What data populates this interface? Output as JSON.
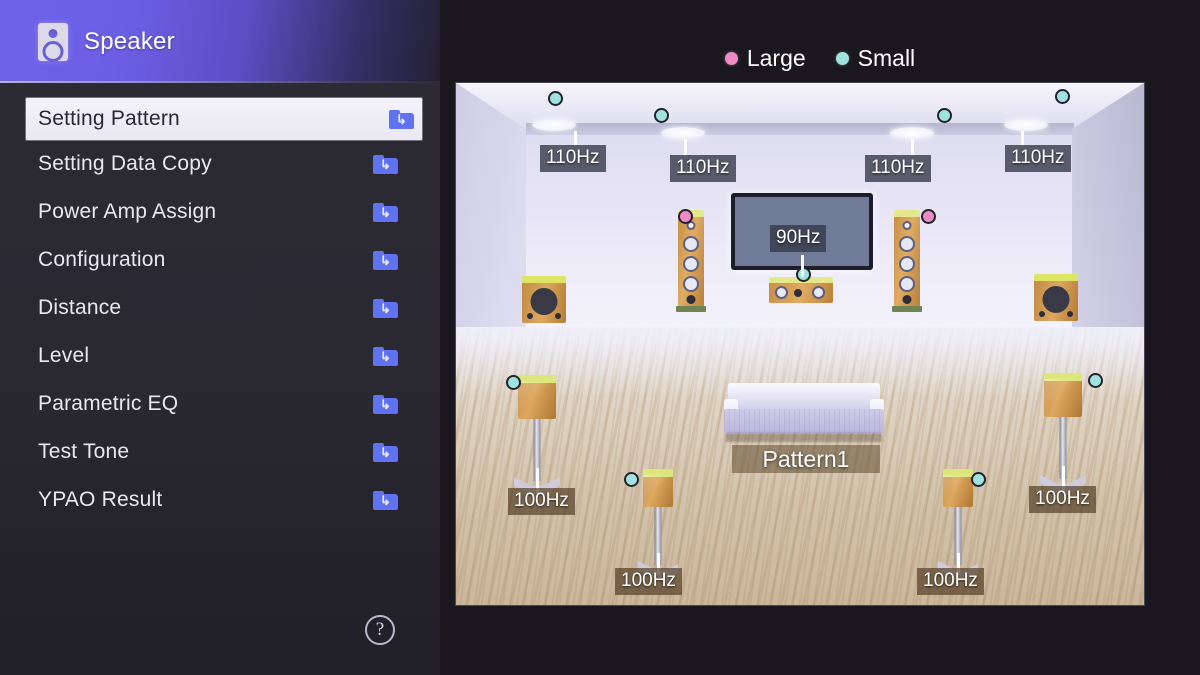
{
  "header": {
    "title": "Speaker",
    "icon": "speaker-icon"
  },
  "menu": {
    "items": [
      {
        "label": "Setting Pattern",
        "icon": "folder-arrow-icon",
        "selected": true
      },
      {
        "label": "Setting Data Copy",
        "icon": "folder-arrow-icon",
        "selected": false
      },
      {
        "label": "Power Amp Assign",
        "icon": "folder-arrow-icon",
        "selected": false
      },
      {
        "label": "Configuration",
        "icon": "folder-arrow-icon",
        "selected": false
      },
      {
        "label": "Distance",
        "icon": "folder-arrow-icon",
        "selected": false
      },
      {
        "label": "Level",
        "icon": "folder-arrow-icon",
        "selected": false
      },
      {
        "label": "Parametric EQ",
        "icon": "folder-arrow-icon",
        "selected": false
      },
      {
        "label": "Test Tone",
        "icon": "folder-arrow-icon",
        "selected": false
      },
      {
        "label": "YPAO Result",
        "icon": "folder-arrow-icon",
        "selected": false
      }
    ]
  },
  "help": {
    "glyph": "?",
    "icon": "help-circle-icon"
  },
  "legend": {
    "entries": [
      {
        "label": "Large",
        "color": "#f08ac4"
      },
      {
        "label": "Small",
        "color": "#9fe2e0"
      }
    ]
  },
  "room": {
    "pattern_label": "Pattern1",
    "crossovers": {
      "presence_front_left": "110Hz",
      "presence_front_right": "110Hz",
      "presence_rear_left": "110Hz",
      "presence_rear_right": "110Hz",
      "center": "90Hz",
      "surround_left": "100Hz",
      "surround_right": "100Hz",
      "surround_back_left": "100Hz",
      "surround_back_right": "100Hz"
    },
    "speakers": [
      {
        "name": "presence-front-left",
        "size": "Small",
        "marker_color": "#9fe2e0",
        "crossover": "110Hz"
      },
      {
        "name": "presence-front-right",
        "size": "Small",
        "marker_color": "#9fe2e0",
        "crossover": "110Hz"
      },
      {
        "name": "presence-rear-left",
        "size": "Small",
        "marker_color": "#9fe2e0",
        "crossover": "110Hz"
      },
      {
        "name": "presence-rear-right",
        "size": "Small",
        "marker_color": "#9fe2e0",
        "crossover": "110Hz"
      },
      {
        "name": "front-left",
        "size": "Large",
        "marker_color": "#f08ac4",
        "crossover": ""
      },
      {
        "name": "front-right",
        "size": "Large",
        "marker_color": "#f08ac4",
        "crossover": ""
      },
      {
        "name": "center",
        "size": "Small",
        "marker_color": "#9fe2e0",
        "crossover": "90Hz"
      },
      {
        "name": "surround-left",
        "size": "Small",
        "marker_color": "#9fe2e0",
        "crossover": "100Hz"
      },
      {
        "name": "surround-right",
        "size": "Small",
        "marker_color": "#9fe2e0",
        "crossover": "100Hz"
      },
      {
        "name": "surround-back-left",
        "size": "Small",
        "marker_color": "#9fe2e0",
        "crossover": "100Hz"
      },
      {
        "name": "surround-back-right",
        "size": "Small",
        "marker_color": "#9fe2e0",
        "crossover": "100Hz"
      },
      {
        "name": "subwoofer-left",
        "size": "",
        "marker_color": "",
        "crossover": ""
      },
      {
        "name": "subwoofer-right",
        "size": "",
        "marker_color": "",
        "crossover": ""
      }
    ]
  },
  "colors": {
    "accent_purple": "#6b5fe6",
    "folder_blue": "#5f72ef",
    "large_pink": "#f08ac4",
    "small_cyan": "#9fe2e0",
    "sidebar_bg": "#2a2831",
    "selected_row_bg": "#f1f0f8"
  }
}
